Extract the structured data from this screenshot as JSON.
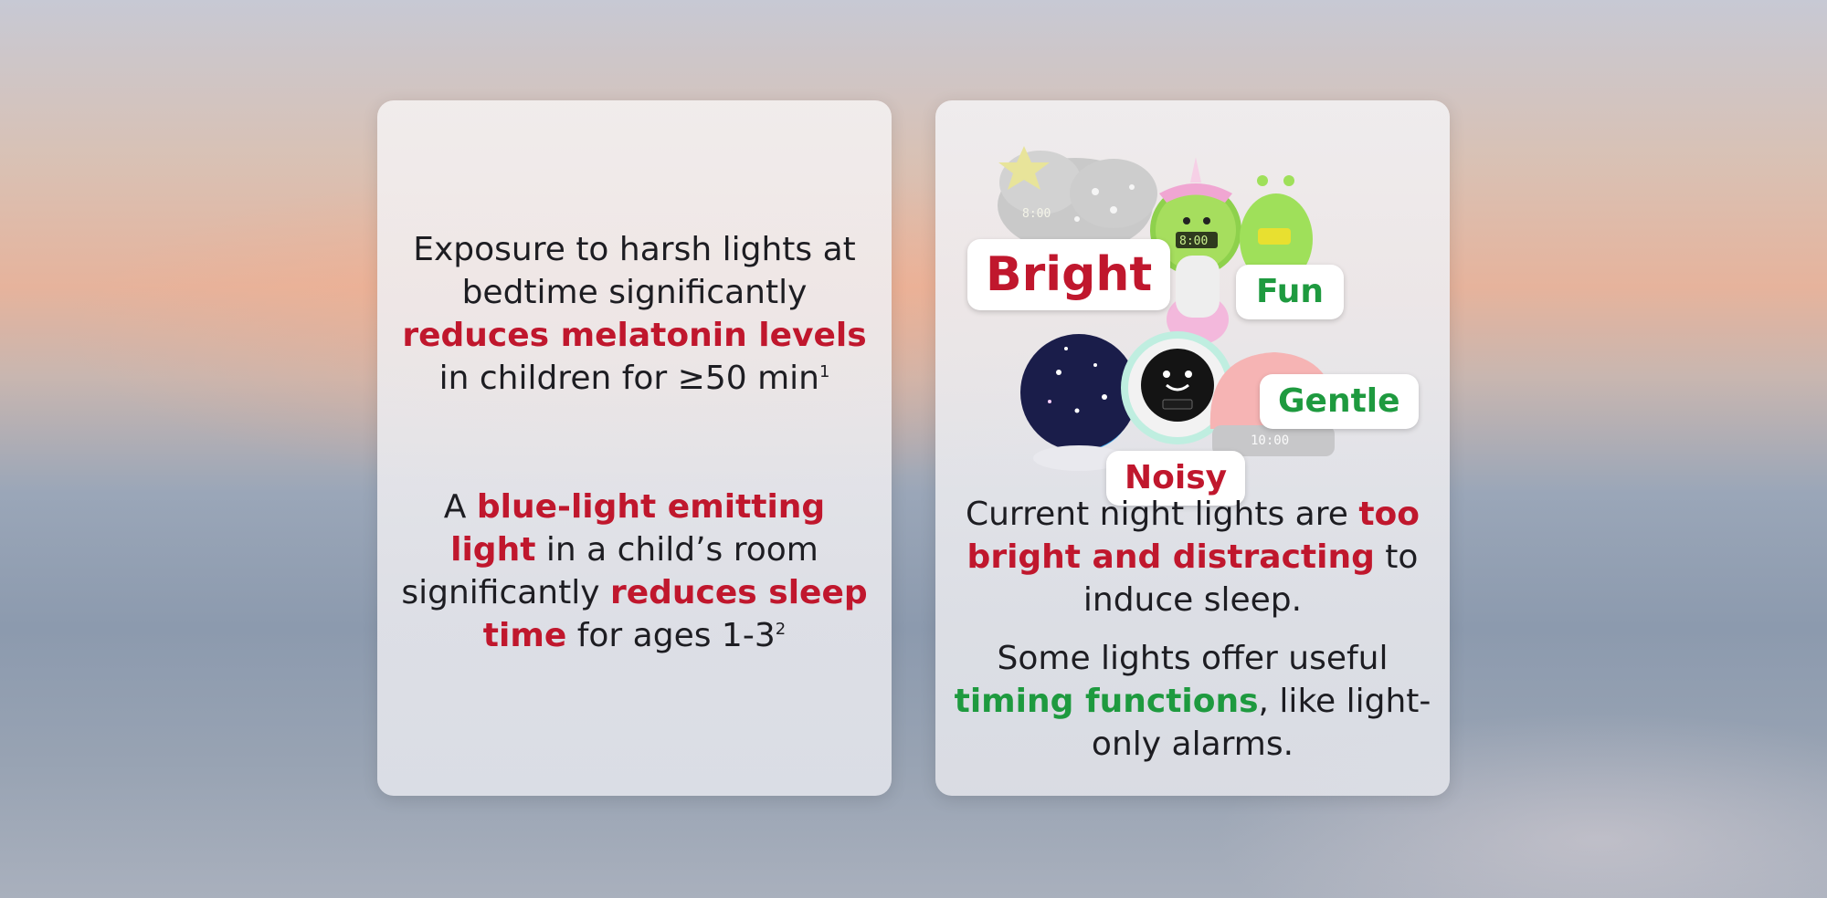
{
  "left_card": {
    "p1": {
      "a": "Exposure to harsh lights at bedtime significantly ",
      "b": "reduces melatonin levels",
      "c": " in children for ≥50 min",
      "ref": "1"
    },
    "p2": {
      "a": "A ",
      "b": "blue-light emitting light",
      "c": " in a child’s room significantly ",
      "d": "reduces sleep time",
      "e": " for ages 1-3",
      "ref": "2"
    }
  },
  "right_card": {
    "tags": {
      "bright": "Bright",
      "fun": "Fun",
      "gentle": "Gentle",
      "noisy": "Noisy"
    },
    "device_display": {
      "clock1": "8:00",
      "clock2": "8:00",
      "clock3": "10:00"
    },
    "p3": {
      "a": "Current night lights are ",
      "b": "too bright and distracting",
      "c": " to induce sleep."
    },
    "p4": {
      "a": "Some lights offer useful ",
      "b": "timing functions",
      "c": ", like light-only alarms."
    }
  },
  "colors": {
    "highlight_red": "#c0172d",
    "highlight_green": "#1e9a3f"
  }
}
